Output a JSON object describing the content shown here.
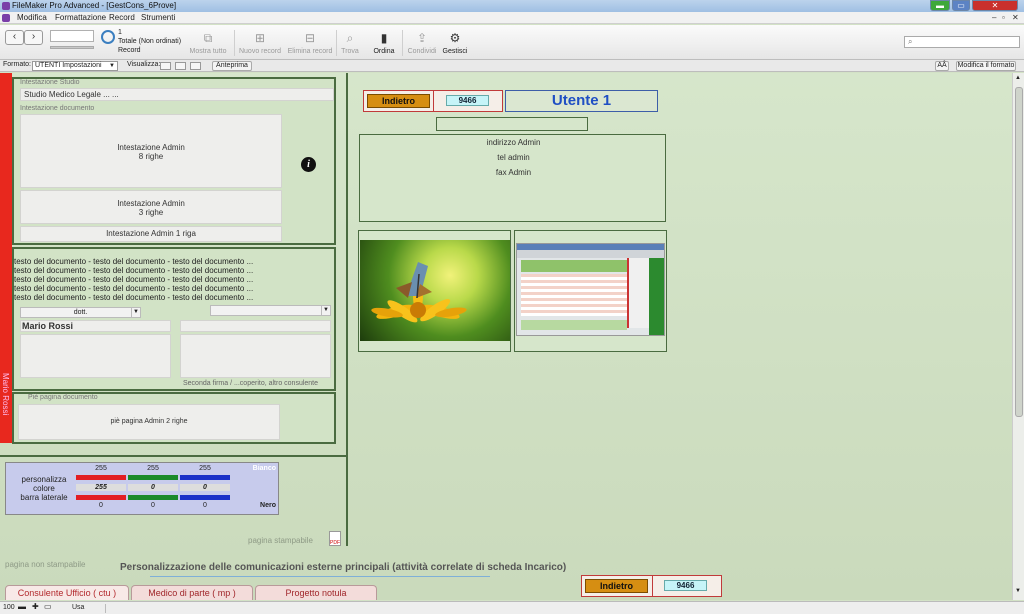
{
  "window": {
    "title": "FileMaker Pro Advanced - [GestCons_6Prove]"
  },
  "menu": [
    "Modifica",
    "Formattazione",
    "Record",
    "Strumenti"
  ],
  "toolbar": {
    "record_number": "1",
    "record_total": "Totale (Non ordinati)",
    "record_label": "Record",
    "items": [
      {
        "label": "Mostra tutto",
        "enabled": false
      },
      {
        "label": "Nuovo record",
        "enabled": false
      },
      {
        "label": "Elimina record",
        "enabled": false
      },
      {
        "label": "Trova",
        "enabled": false
      },
      {
        "label": "Ordina",
        "enabled": true
      },
      {
        "label": "Condividi",
        "enabled": false
      },
      {
        "label": "Gestisci",
        "enabled": true
      }
    ]
  },
  "layoutbar": {
    "format_label": "Formato:",
    "format_value": "UTENTI Impostazioni",
    "view_label": "Visualizza:",
    "preview_btn": "Anteprima",
    "font_btn": "AÂ",
    "edit_format_btn": "Modifica il formato"
  },
  "left": {
    "studio_header_label": "Intestazione Studio",
    "studio_value": "Studio Medico Legale ... ...",
    "doc_header_label": "Intestazione documento",
    "admin8_line1": "Intestazione Admin",
    "admin8_line2": "8 righe",
    "admin3_line1": "Intestazione Admin",
    "admin3_line2": "3 righe",
    "admin1": "Intestazione Admin 1 riga",
    "body_lines": [
      "testo del documento - testo del documento - testo del documento ...",
      "testo del documento - testo del documento - testo del documento ...",
      "testo del documento - testo del documento - testo del documento ...",
      "testo del documento - testo del documento - testo del documento ...",
      "testo del documento - testo del documento - testo del documento ..."
    ],
    "title_select": "dott.",
    "signer_name": "Mario Rossi",
    "second_sig_note": "Seconda firma / ...coperito, altro consulente",
    "footer_label": "Piè pagina documento",
    "footer_value": "piè pagina Admin 2 righe",
    "red_bar_name": "Mario Rossi"
  },
  "color_panel": {
    "label_lines": [
      "personalizza",
      "colore",
      "barra laterale"
    ],
    "top_values": [
      "255",
      "255",
      "255"
    ],
    "top_label": "Bianco",
    "mid_values": [
      "255",
      "0",
      "0"
    ],
    "bottom_values": [
      "0",
      "0",
      "0"
    ],
    "bottom_label": "Nero",
    "colors": {
      "red": "#e21e24",
      "green": "#1c8a2b",
      "blue": "#1b31c8"
    }
  },
  "print_labels": {
    "stampabile": "pagina stampabile",
    "non_stampabile": "pagina non stampabile",
    "pdf": "PDF"
  },
  "section_title": "Personalizzazione delle comunicazioni esterne principali (attività correlate di scheda Incarico)",
  "right": {
    "back_btn": "Indietro",
    "record_id": "9466",
    "user_title": "Utente 1",
    "address": "indirizzo Admin",
    "phone": "tel admin",
    "fax": "fax Admin"
  },
  "tabs": [
    {
      "label": "Consulente Ufficio ( ctu )",
      "active": true
    },
    {
      "label": "Medico di parte ( mp )",
      "active": false
    },
    {
      "label": "Progetto notula",
      "active": false
    }
  ],
  "statusbar": {
    "zoom": "100",
    "mode": "Usa"
  }
}
